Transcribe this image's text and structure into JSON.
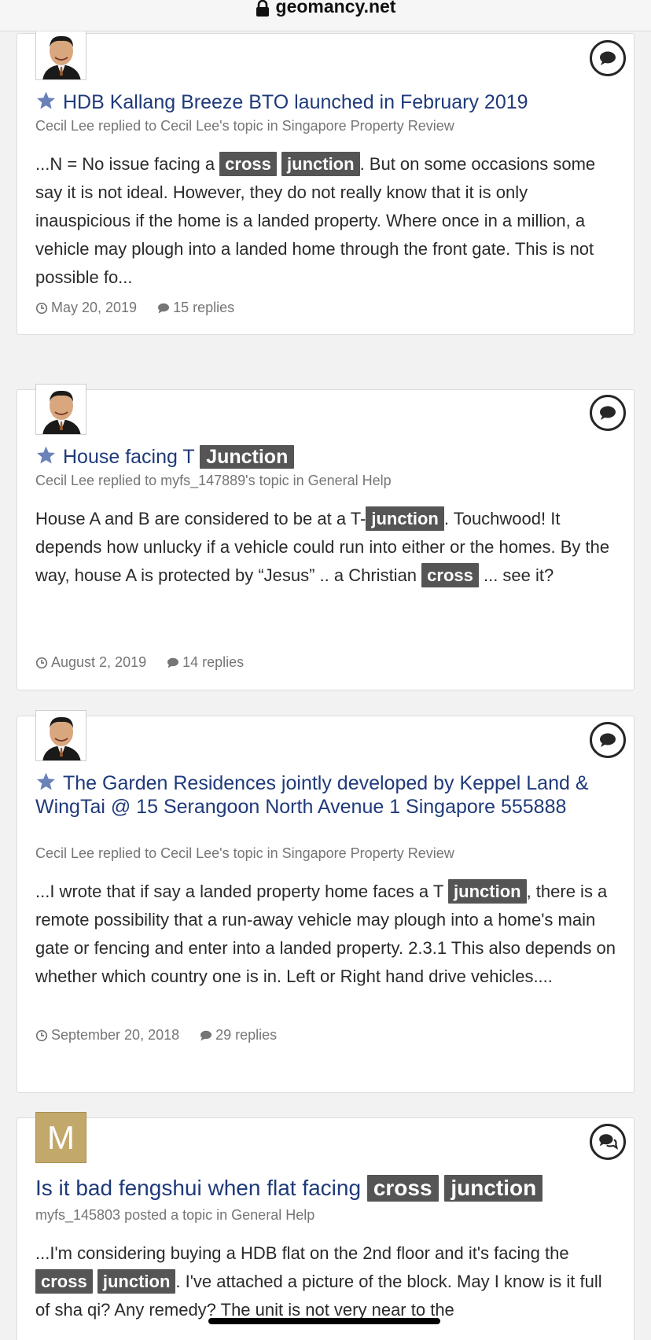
{
  "browser": {
    "domain": "geomancy.net"
  },
  "results": [
    {
      "avatar_type": "photo",
      "title_parts": [
        "HDB Kallang Breeze BTO launched in February 2019"
      ],
      "meta": "Cecil Lee replied to Cecil Lee's topic in Singapore Property Review",
      "snippet_parts": [
        "...N = No issue facing a ",
        "cross",
        " ",
        "junction",
        ". But on some occasions some say it is not ideal. However, they do not really know that it is only inauspicious if the home is a landed property. Where once in a million, a vehicle may plough into a landed home through the front gate. This is not possible fo..."
      ],
      "date": "May 20, 2019",
      "replies": "15 replies"
    },
    {
      "avatar_type": "photo",
      "title_parts": [
        "House facing T ",
        "Junction"
      ],
      "meta": "Cecil Lee replied to myfs_147889's topic in General Help",
      "snippet_parts": [
        "House A and B are considered to be at a T-",
        "junction",
        ". Touchwood! It depends how unlucky if a vehicle could run into either or the homes. By the way, house A is protected by “Jesus” .. a Christian ",
        "cross",
        " ... see it?"
      ],
      "date": "August 2, 2019",
      "replies": "14 replies"
    },
    {
      "avatar_type": "photo",
      "title_parts": [
        "The Garden Residences jointly developed by Keppel Land & WingTai @ 15 Serangoon North Avenue 1 Singapore 555888"
      ],
      "meta": "Cecil Lee replied to Cecil Lee's topic in Singapore Property Review",
      "snippet_parts": [
        "...I wrote that if say a landed property home faces a T ",
        "junction",
        ", there is a remote possibility that a run-away vehicle may plough into a home's main gate or fencing and enter into a landed property. 2.3.1 This also depends on whether which country one is in. Left or Right hand drive vehicles...."
      ],
      "date": "September 20, 2018",
      "replies": "29 replies"
    },
    {
      "avatar_type": "letter",
      "avatar_letter": "M",
      "title_parts": [
        "Is it bad fengshui when flat facing ",
        "cross",
        " ",
        "junction"
      ],
      "meta": "myfs_145803 posted a topic in General Help",
      "snippet_parts": [
        "...I'm considering buying a HDB flat on the 2nd floor and it's facing the ",
        "cross",
        " ",
        "junction",
        ". I've attached a picture of the block. May I know is it full of sha qi? Any remedy? The unit is not very near to the"
      ]
    }
  ],
  "colors": {
    "title": "#1f3a7a",
    "highlight_bg": "#555555",
    "meta": "#757575",
    "avatar_letter_bg": "#c2a86a"
  },
  "icons": {
    "lock": "lock-icon",
    "follow": "star-icon",
    "topic": "comment-bubble-icon",
    "date": "clock-icon",
    "replies": "comment-icon"
  }
}
